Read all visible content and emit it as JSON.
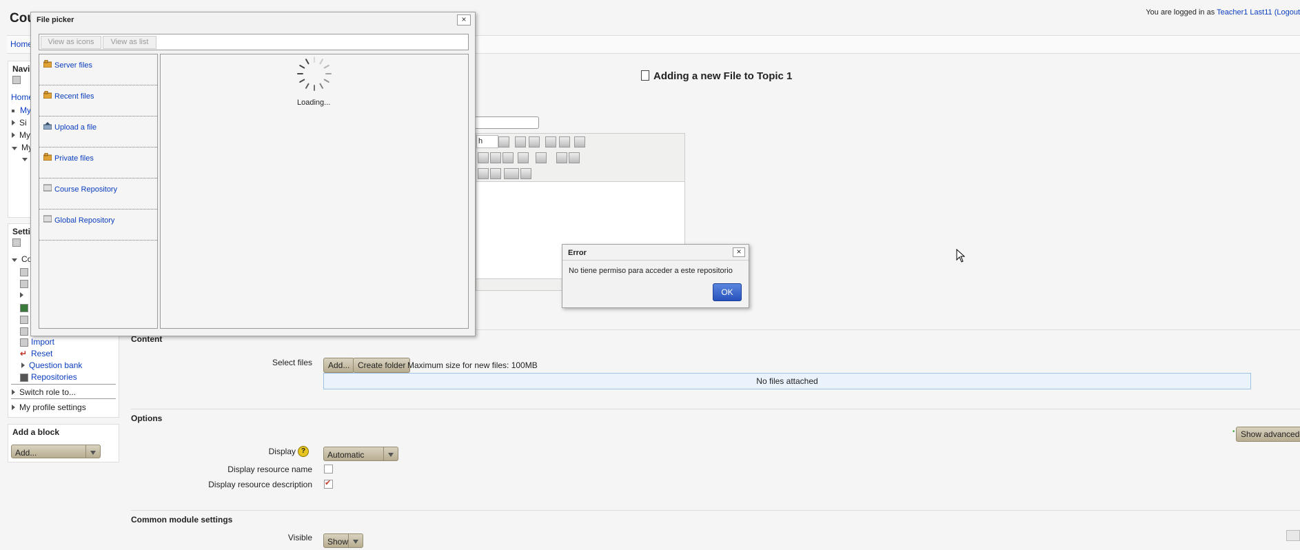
{
  "header": {
    "page_heading": "Cou",
    "login_prefix": "You are logged in as",
    "user_name": "Teacher1 Last11",
    "logout": "(Logout"
  },
  "navbar": {
    "home": "Home"
  },
  "navigation_block": {
    "title": "Navi",
    "home": "Home",
    "items": [
      "My",
      "Si",
      "My",
      "My"
    ]
  },
  "settings_block": {
    "title": "Setti",
    "items": [
      "Co",
      "Import",
      "Reset",
      "Question bank",
      "Repositories",
      "Switch role to...",
      "My profile settings"
    ]
  },
  "add_block": {
    "title": "Add a block",
    "select_value": "Add..."
  },
  "main": {
    "title": "Adding a new File to Topic 1",
    "editor_fragment": "h",
    "content_section": {
      "legend": "Content",
      "select_files_label": "Select files",
      "add_button": "Add...",
      "create_folder_button": "Create folder",
      "max_size": "Maximum size for new files: 100MB",
      "no_files": "No files attached"
    },
    "options_section": {
      "legend": "Options",
      "show_advanced": "Show advanced",
      "display_label": "Display",
      "display_value": "Automatic",
      "display_name_label": "Display resource name",
      "display_desc_label": "Display resource description",
      "display_name_checked": false,
      "display_desc_checked": true
    },
    "common_section": {
      "legend": "Common module settings",
      "visible_label": "Visible",
      "visible_value": "Show"
    }
  },
  "file_picker": {
    "title": "File picker",
    "close": "×",
    "view_icons": "View as icons",
    "view_list": "View as list",
    "repositories": [
      {
        "label": "Server files",
        "icon": "server-files-icon"
      },
      {
        "label": "Recent files",
        "icon": "recent-files-icon"
      },
      {
        "label": "Upload a file",
        "icon": "upload-icon"
      },
      {
        "label": "Private files",
        "icon": "private-files-icon"
      },
      {
        "label": "Course Repository",
        "icon": "repository-icon"
      },
      {
        "label": "Global Repository",
        "icon": "repository-icon"
      }
    ],
    "loading_text": "Loading..."
  },
  "error_dialog": {
    "title": "Error",
    "close": "×",
    "message": "No tiene permiso para acceder a este repositorio",
    "ok_button": "OK"
  },
  "colors": {
    "link": "#0a3dbf",
    "ok_button": "#2752bd",
    "button_bg": "#c8bfa6",
    "files_area_bg": "#eaf3fc"
  }
}
